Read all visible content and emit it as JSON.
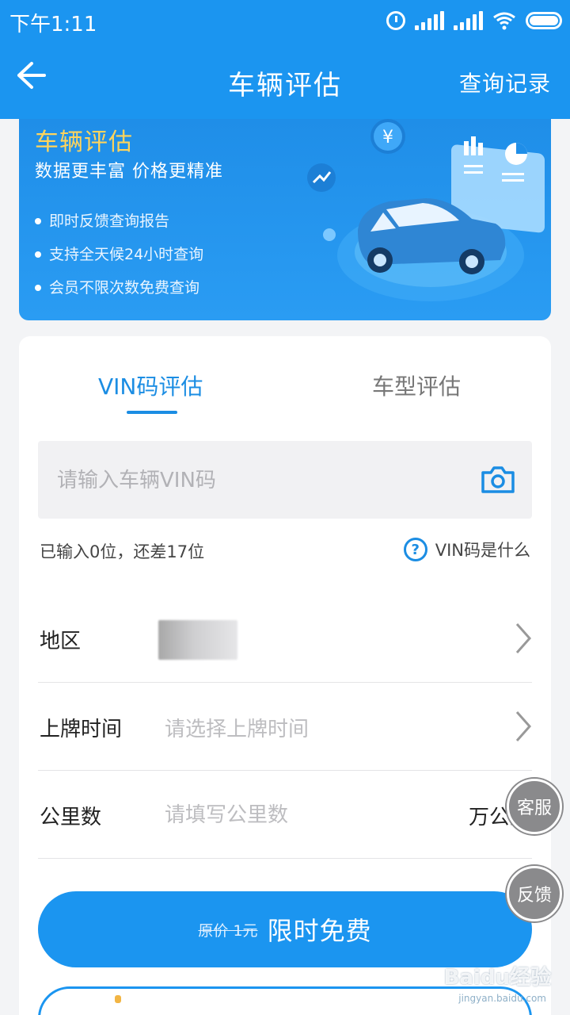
{
  "status_bar": {
    "time": "下午1:11"
  },
  "header": {
    "title": "车辆评估",
    "records": "查询记录"
  },
  "banner": {
    "title": "车辆评估",
    "subtitle": "数据更丰富 价格更精准",
    "features": [
      "即时反馈查询报告",
      "支持全天候24小时查询",
      "会员不限次数免费查询"
    ],
    "currency_badge": "¥"
  },
  "tabs": [
    {
      "label": "VIN码评估",
      "active": true
    },
    {
      "label": "车型评估",
      "active": false
    }
  ],
  "vin": {
    "placeholder": "请输入车辆VIN码",
    "hint": "已输入0位，还差17位",
    "help_label": "VIN码是什么",
    "help_icon": "?"
  },
  "fields": {
    "region": {
      "label": "地区"
    },
    "plate_date": {
      "label": "上牌时间",
      "placeholder": "请选择上牌时间"
    },
    "mileage": {
      "label": "公里数",
      "placeholder": "请填写公里数",
      "unit": "万公里"
    }
  },
  "submit": {
    "original_price": "原价 1元",
    "label": "限时免费"
  },
  "floating": {
    "service": "客服",
    "feedback": "反馈"
  },
  "watermark": {
    "brand": "Baidu经验",
    "url": "jingyan.baidu.com"
  },
  "colors": {
    "primary": "#1b95f0",
    "accent_tab": "#1b8de3",
    "banner_title": "#ffd45c"
  }
}
